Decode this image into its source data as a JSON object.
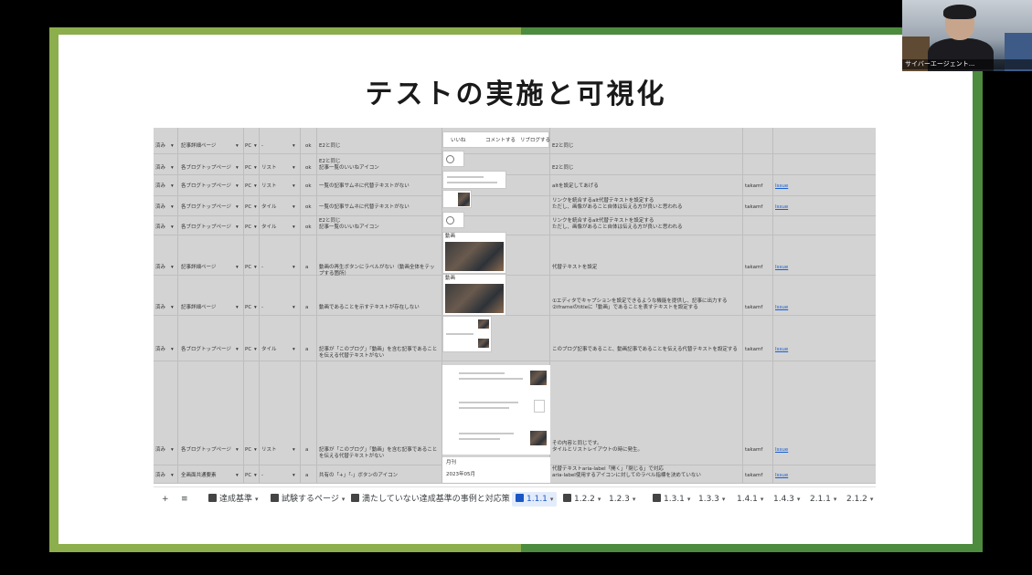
{
  "slide": {
    "title": "テストの実施と可視化"
  },
  "webcam": {
    "label": "サイバーエージェント..."
  },
  "sheet": {
    "rows": [
      {
        "status": "済み",
        "page": "記事詳細ページ",
        "device": "PC",
        "type": "-",
        "result": "ok",
        "issue": "E2と同じ",
        "fix": "E2と同じ",
        "owner": "",
        "link": ""
      },
      {
        "status": "済み",
        "page": "各ブログトップページ",
        "device": "PC",
        "type": "リスト",
        "result": "ok",
        "issue": "E2と同じ\n記事一覧のいいねアイコン",
        "fix": "E2と同じ",
        "owner": "",
        "link": ""
      },
      {
        "status": "済み",
        "page": "各ブログトップページ",
        "device": "PC",
        "type": "リスト",
        "result": "ok",
        "issue": "一覧の記事サムネに代替テキストがない",
        "fix": "altを設定してあげる",
        "owner": "takamf",
        "link": "Issue"
      },
      {
        "status": "済み",
        "page": "各ブログトップページ",
        "device": "PC",
        "type": "タイル",
        "result": "ok",
        "issue": "一覧の記事サムネに代替テキストがない",
        "fix": "リンクを統合するalt代替テキストを設定する\nただし、画像があること自体は伝える方が良いと思われる",
        "owner": "takamf",
        "link": "Issue"
      },
      {
        "status": "済み",
        "page": "各ブログトップページ",
        "device": "PC",
        "type": "タイル",
        "result": "ok",
        "issue": "E2と同じ\n記事一覧のいいねアイコン",
        "fix": "リンクを統合するalt代替テキストを設定する\nただし、画像があること自体は伝える方が良いと思われる",
        "owner": "",
        "link": ""
      },
      {
        "status": "済み",
        "page": "記事詳細ページ",
        "device": "PC",
        "type": "-",
        "result": "a",
        "issue": "動画の再生ボタンにラベルがない（動画全体をテップする箇所）",
        "fix": "代替テキストを設定",
        "owner": "takamf",
        "link": "Issue"
      },
      {
        "status": "済み",
        "page": "記事詳細ページ",
        "device": "PC",
        "type": "-",
        "result": "a",
        "issue": "動画であることを示すテキストが存在しない",
        "fix": "①エディタでキャプションを設定できるような機能を提供し、記事に出力する\n②iframeのtitleに「動画」であることを表すテキストを設定する",
        "owner": "takamf",
        "link": "Issue"
      },
      {
        "status": "済み",
        "page": "各ブログトップページ",
        "device": "PC",
        "type": "タイル",
        "result": "a",
        "issue": "記事が「このブログ」「動画」を含む記事であることを伝える代替テキストがない",
        "fix": "このブログ記事であること、動画記事であることを伝える代替テキストを設定する",
        "owner": "takamf",
        "link": "Issue"
      },
      {
        "status": "済み",
        "page": "各ブログトップページ",
        "device": "PC",
        "type": "リスト",
        "result": "a",
        "issue": "記事が「このブログ」「動画」を含む記事であることを伝える代替テキストがない",
        "fix": "その内容と同じです。\nタイルとリストレイアウトの時に発生。",
        "owner": "takamf",
        "link": "Issue"
      },
      {
        "status": "済み",
        "page": "全画面共通要素",
        "device": "PC",
        "type": "-",
        "result": "a",
        "issue": "共有の「+」「-」ボタンのアイコン",
        "fix": "代替テキストaria-label「開く」「閉じる」で対応\naria-label使用するアイコンに対してのラベル指標を決めていない",
        "owner": "takamf",
        "link": "Issue"
      }
    ],
    "screenshot_labels": {
      "like": "いいね",
      "comment": "コメントする",
      "reblog": "リブログする",
      "video": "動画",
      "note": "月刊",
      "date": "2023年05月"
    }
  },
  "tabs": [
    {
      "label": "達成基準",
      "num": "2"
    },
    {
      "label": "試験するページ",
      "num": "3"
    },
    {
      "label": "満たしていない達成基準の事例と対応策",
      "num": "4"
    },
    {
      "label": "1.1.1",
      "num": "4",
      "active": true
    },
    {
      "label": "1.2.2",
      "num": "1"
    },
    {
      "label": "1.2.3",
      "num": ""
    },
    {
      "label": "1.3.1",
      "num": "1"
    },
    {
      "label": "1.3.3",
      "num": ""
    },
    {
      "label": "1.4.1",
      "num": ""
    },
    {
      "label": "1.4.3",
      "num": ""
    },
    {
      "label": "2.1.1",
      "num": ""
    },
    {
      "label": "2.1.2",
      "num": ""
    }
  ],
  "toolbar": {
    "add_icon": "+",
    "menu_icon": "≡"
  }
}
